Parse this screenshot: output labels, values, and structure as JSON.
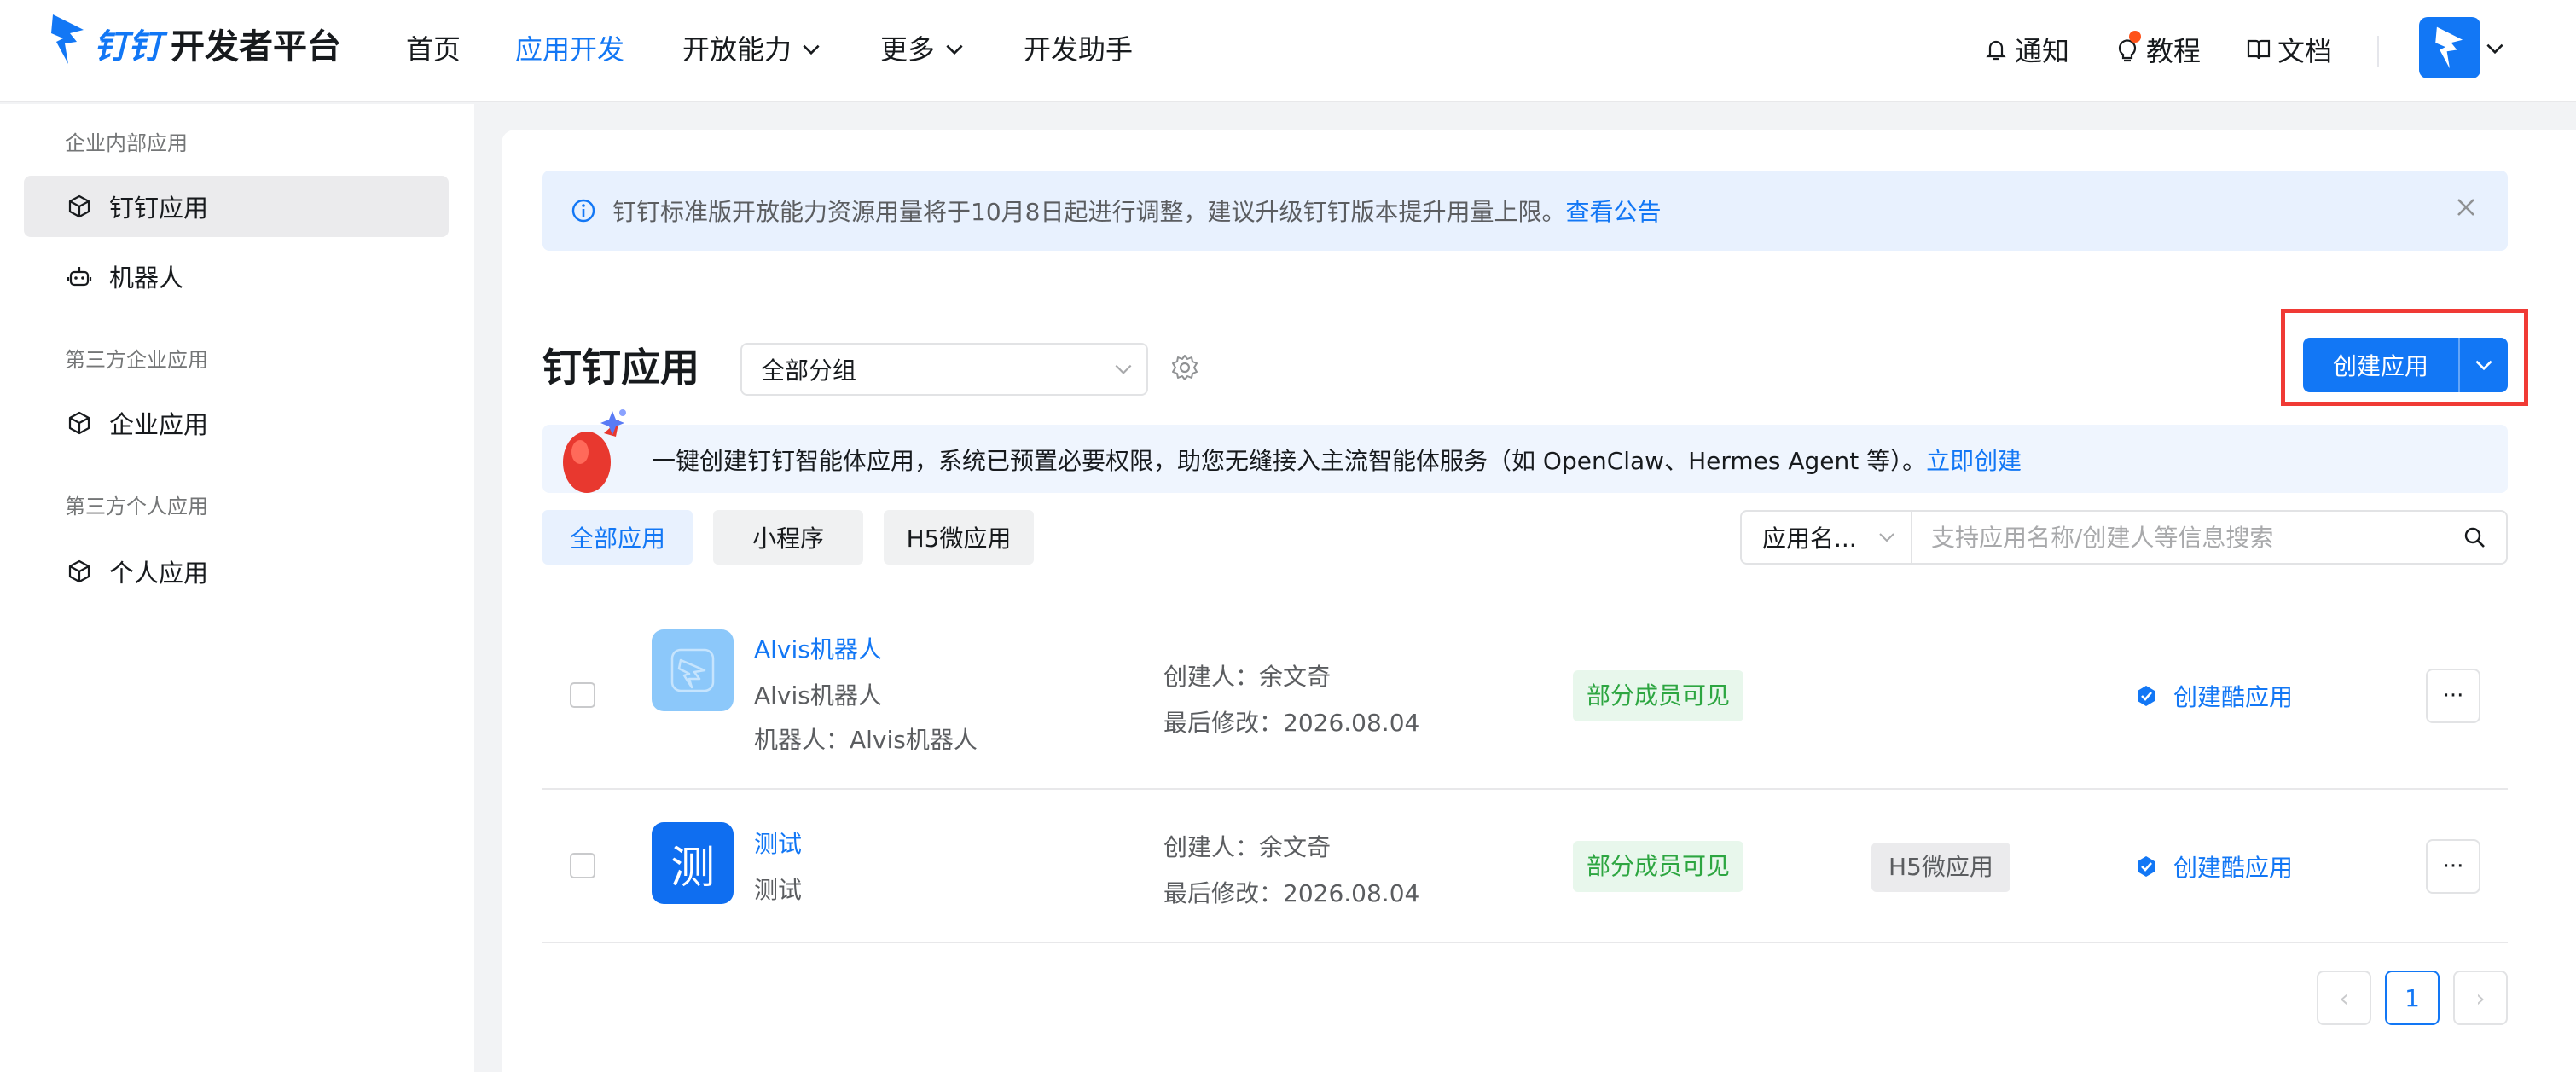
{
  "brand": {
    "logo_prefix": "钉钉",
    "logo_suffix": "开发者平台"
  },
  "nav": {
    "items": [
      {
        "label": "首页"
      },
      {
        "label": "应用开发"
      },
      {
        "label": "开放能力"
      },
      {
        "label": "更多"
      },
      {
        "label": "开发助手"
      }
    ],
    "active_index": 1
  },
  "toolbar": {
    "notify_label": "通知",
    "tutorial_label": "教程",
    "docs_label": "文档"
  },
  "sidebar": {
    "group1": "企业内部应用",
    "group2": "第三方企业应用",
    "group3": "第三方个人应用",
    "items": [
      {
        "label": "钉钉应用",
        "icon": "cube-icon"
      },
      {
        "label": "机器人",
        "icon": "robot-icon"
      },
      {
        "label": "企业应用",
        "icon": "cube-icon"
      },
      {
        "label": "个人应用",
        "icon": "cube-icon"
      }
    ]
  },
  "notice": {
    "text": "钉钉标准版开放能力资源用量将于10月8日起进行调整，建议升级钉钉版本提升用量上限。",
    "link": "查看公告"
  },
  "page": {
    "title": "钉钉应用",
    "group_select": "全部分组",
    "create_label": "创建应用"
  },
  "promo": {
    "text": "一键创建钉钉智能体应用，系统已预置必要权限，助您无缝接入主流智能体服务（如 OpenClaw、Hermes Agent 等）。",
    "link": "立即创建"
  },
  "tabs": [
    {
      "label": "全部应用"
    },
    {
      "label": "小程序"
    },
    {
      "label": "H5微应用"
    }
  ],
  "search": {
    "scope": "应用名...",
    "placeholder": "支持应用名称/创建人等信息搜索"
  },
  "apps": [
    {
      "name": "Alvis机器人",
      "sub1": "Alvis机器人",
      "sub2": "机器人：Alvis机器人",
      "creator": "创建人：余文奇",
      "modified": "最后修改：2026.08.04",
      "visibility": "部分成员可见",
      "type_badge": "",
      "action": "创建酷应用",
      "more": "···"
    },
    {
      "name": "测试",
      "sub1": "测试",
      "icon_char": "测",
      "creator": "创建人：余文奇",
      "modified": "最后修改：2026.08.04",
      "visibility": "部分成员可见",
      "type_badge": "H5微应用",
      "action": "创建酷应用",
      "more": "···"
    }
  ],
  "pagination": {
    "current": "1",
    "prev": "‹",
    "next": "›"
  },
  "colors": {
    "accent": "#1277f5",
    "highlight_border": "#f03a35",
    "success": "#2da641"
  }
}
